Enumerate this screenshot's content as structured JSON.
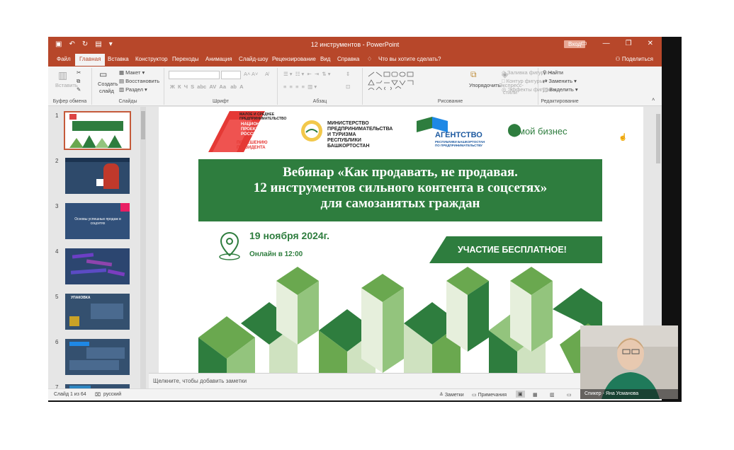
{
  "window": {
    "title": "12 инструментов  -  PowerPoint",
    "signin": "Вход"
  },
  "tabs": [
    {
      "label": "Файл"
    },
    {
      "label": "Главная"
    },
    {
      "label": "Вставка"
    },
    {
      "label": "Конструктор"
    },
    {
      "label": "Переходы"
    },
    {
      "label": "Анимация"
    },
    {
      "label": "Слайд-шоу"
    },
    {
      "label": "Рецензирование"
    },
    {
      "label": "Вид"
    },
    {
      "label": "Справка"
    }
  ],
  "tell_me": "Что вы хотите сделать?",
  "share": "Поделиться",
  "ribbon": {
    "clipboard": {
      "paste": "Вставить",
      "label": "Буфер обмена"
    },
    "slides": {
      "new_slide_1": "Создать",
      "new_slide_2": "слайд",
      "layout": "Макет",
      "reset": "Восстановить",
      "section": "Раздел",
      "label": "Слайды"
    },
    "font": {
      "label": "Шрифт"
    },
    "paragraph": {
      "label": "Абзац"
    },
    "drawing": {
      "arrange": "Упорядочить",
      "quick_styles_1": "Экспресс-",
      "quick_styles_2": "стили",
      "fill": "Заливка фигуры",
      "outline": "Контур фигуры",
      "effects": "Эффекты фигуры",
      "label": "Рисование"
    },
    "editing": {
      "find": "Найти",
      "replace": "Заменить",
      "select": "Выделить",
      "label": "Редактирование"
    }
  },
  "thumbnails": [
    {
      "num": "1",
      "text": ""
    },
    {
      "num": "2",
      "text": ""
    },
    {
      "num": "3",
      "text": "Основы успешных продаж в соцсетях"
    },
    {
      "num": "4",
      "text": ""
    },
    {
      "num": "5",
      "text": "УПАКОВКА"
    },
    {
      "num": "6",
      "text": ""
    },
    {
      "num": "7",
      "text": ""
    }
  ],
  "slide": {
    "logo1": {
      "line1": "МАЛОЕ И СРЕДНЕЕ",
      "line2": "ПРЕДПРИНИМАТЕЛЬСТВО",
      "line3": "НАЦИОНАЛЬНЫЕ",
      "line4": "ПРОЕКТЫ",
      "line5": "РОССИИ",
      "line6": "ПО РЕШЕНИЮ",
      "line7": "ПРЕЗИДЕНТА"
    },
    "logo2": {
      "line1": "МИНИСТЕРСТВО",
      "line2": "ПРЕДПРИНИМАТЕЛЬСТВА",
      "line3": "И ТУРИЗМА",
      "line4": "РЕСПУБЛИКИ",
      "line5": "БАШКОРТОСТАН"
    },
    "logo3": {
      "name": "АГЕНТСТВО",
      "sub1": "РЕСПУБЛИКИ БАШКОРТОСТАН",
      "sub2": "ПО ПРЕДПРИНИМАТЕЛЬСТВУ"
    },
    "logo4": {
      "name": "мой бизнес"
    },
    "title_line1": "Вебинар «Как продавать, не продавая.",
    "title_line2": "12 инструментов сильного контента в соцсетях»",
    "title_line3": "для самозанятых граждан",
    "date": "19 ноября 2024г.",
    "time": "Онлайн в 12:00",
    "free": "УЧАСТИЕ БЕСПЛАТНОЕ!"
  },
  "notes_placeholder": "Щелкните, чтобы добавить заметки",
  "status": {
    "slide_counter": "Слайд 1 из 64",
    "language": "русский",
    "notes": "Заметки",
    "comments": "Примечания"
  },
  "webcam": {
    "label": "Спикер - Яна Усманова"
  },
  "colors": {
    "accent": "#b7472a",
    "green": "#2e7d3e"
  }
}
